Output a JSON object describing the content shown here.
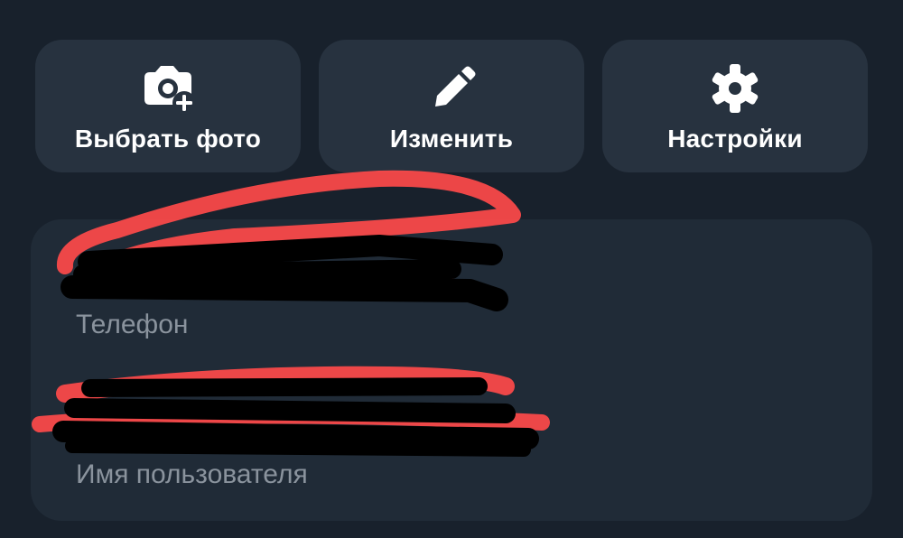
{
  "actions": {
    "choose_photo_label": "Выбрать фото",
    "edit_label": "Изменить",
    "settings_label": "Настройки"
  },
  "profile": {
    "phone_label": "Телефон",
    "phone_value": "",
    "username_label": "Имя пользователя",
    "username_value": ""
  },
  "icons": {
    "choose_photo": "camera-plus-icon",
    "edit": "pencil-icon",
    "settings": "gear-icon"
  },
  "colors": {
    "background": "#18212c",
    "button_bg": "#27323f",
    "card_bg": "#202b37",
    "text_primary": "#ffffff",
    "text_secondary": "#8a939d",
    "redaction_red": "#ff4a4a",
    "redaction_black": "#000000"
  }
}
